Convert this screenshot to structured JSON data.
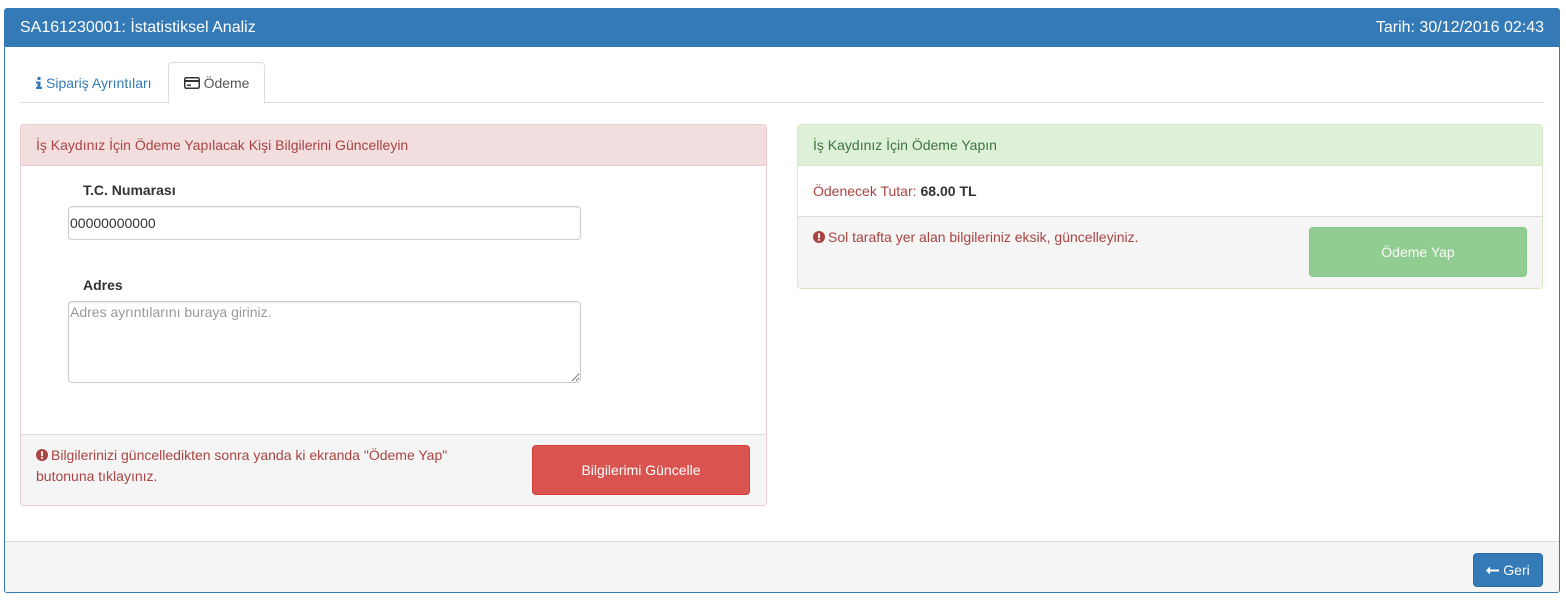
{
  "header": {
    "title": "SA161230001: İstatistiksel Analiz",
    "date": "Tarih: 30/12/2016 02:43"
  },
  "tabs": [
    {
      "label": "Sipariş Ayrıntıları",
      "icon": "info-icon",
      "active": false
    },
    {
      "label": "Ödeme",
      "icon": "credit-card-icon",
      "active": true
    }
  ],
  "info_panel": {
    "heading": "İş Kaydınız İçin Ödeme Yapılacak Kişi Bilgilerini Güncelleyin",
    "tc_label": "T.C. Numarası",
    "tc_value": "00000000000",
    "address_label": "Adres",
    "address_placeholder": "Adres ayrıntılarını buraya giriniz.",
    "address_value": "",
    "note": "Bilgilerinizi güncelledikten sonra yanda ki ekranda \"Ödeme Yap\" butonuna tıklayınız.",
    "update_button": "Bilgilerimi Güncelle"
  },
  "payment_panel": {
    "heading": "İş Kaydınız İçin Ödeme Yapın",
    "amount_label": "Ödenecek Tutar:",
    "amount_value": "68.00 TL",
    "warning": "Sol tarafta yer alan bilgileriniz eksik, güncelleyiniz.",
    "pay_button": "Ödeme Yap"
  },
  "footer": {
    "back_button": "Geri"
  },
  "colors": {
    "primary": "#337ab7",
    "danger": "#d9534f",
    "danger_text": "#a94442",
    "success": "#5cb85c",
    "success_text": "#3c763d"
  }
}
